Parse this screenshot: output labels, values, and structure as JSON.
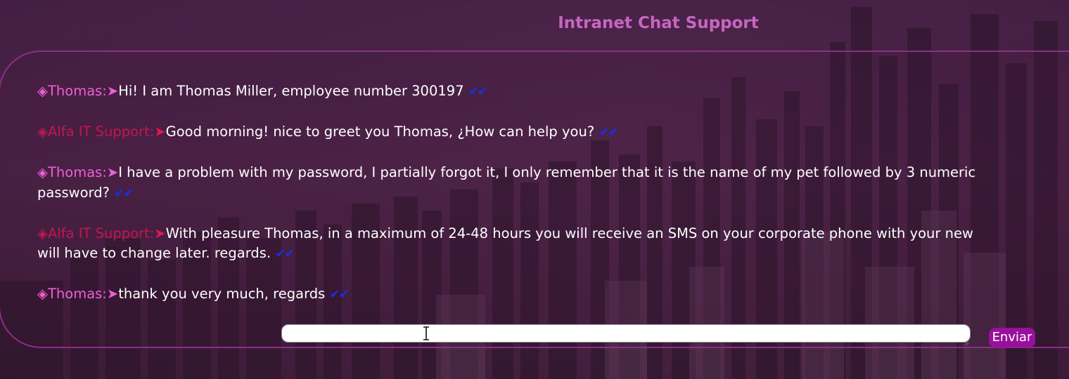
{
  "header": {
    "title": "Intranet Chat Support"
  },
  "messages": [
    {
      "sender": "Thomas:",
      "role": "user",
      "marker": "◈",
      "arrow": "➤",
      "text": "Hi! I am Thomas Miller, employee number 300197",
      "ticks": "✔✔"
    },
    {
      "sender": "Alfa IT Support:",
      "role": "support",
      "marker": "◈",
      "arrow": "➤",
      "text": "Good morning! nice to greet you Thomas, ¿How can help you?",
      "ticks": "✔✔"
    },
    {
      "sender": "Thomas:",
      "role": "user",
      "marker": "◈",
      "arrow": "➤",
      "text": "I have a problem with my password, I partially forgot it, I only remember that it is the name of my pet followed by 3 numeric",
      "text2": "password?",
      "ticks": "✔✔"
    },
    {
      "sender": "Alfa IT Support:",
      "role": "support",
      "marker": "◈",
      "arrow": "➤",
      "text": "With pleasure Thomas, in a maximum of 24-48 hours you will receive an SMS on your corporate phone with your new",
      "text2": "will have to change later. regards.",
      "ticks": "✔✔"
    },
    {
      "sender": "Thomas:",
      "role": "user",
      "marker": "◈",
      "arrow": "➤",
      "text": "thank you very much, regards",
      "ticks": "✔✔"
    }
  ],
  "composer": {
    "value": "",
    "placeholder": "",
    "send_label": "Enviar"
  },
  "colors": {
    "title": "#c766c0",
    "user_sender": "#ee5fd4",
    "support_sender": "#c3164f",
    "ticks": "#1a2fe0",
    "send_button": "#9a0f9c",
    "frame_border": "#8a2f85"
  },
  "icons": {
    "message_marker": "diamond-icon",
    "message_arrow": "arrow-right-icon",
    "read_receipt": "double-check-icon",
    "text_cursor": "text-cursor-icon",
    "resize_handle": "resize-handle-icon"
  }
}
